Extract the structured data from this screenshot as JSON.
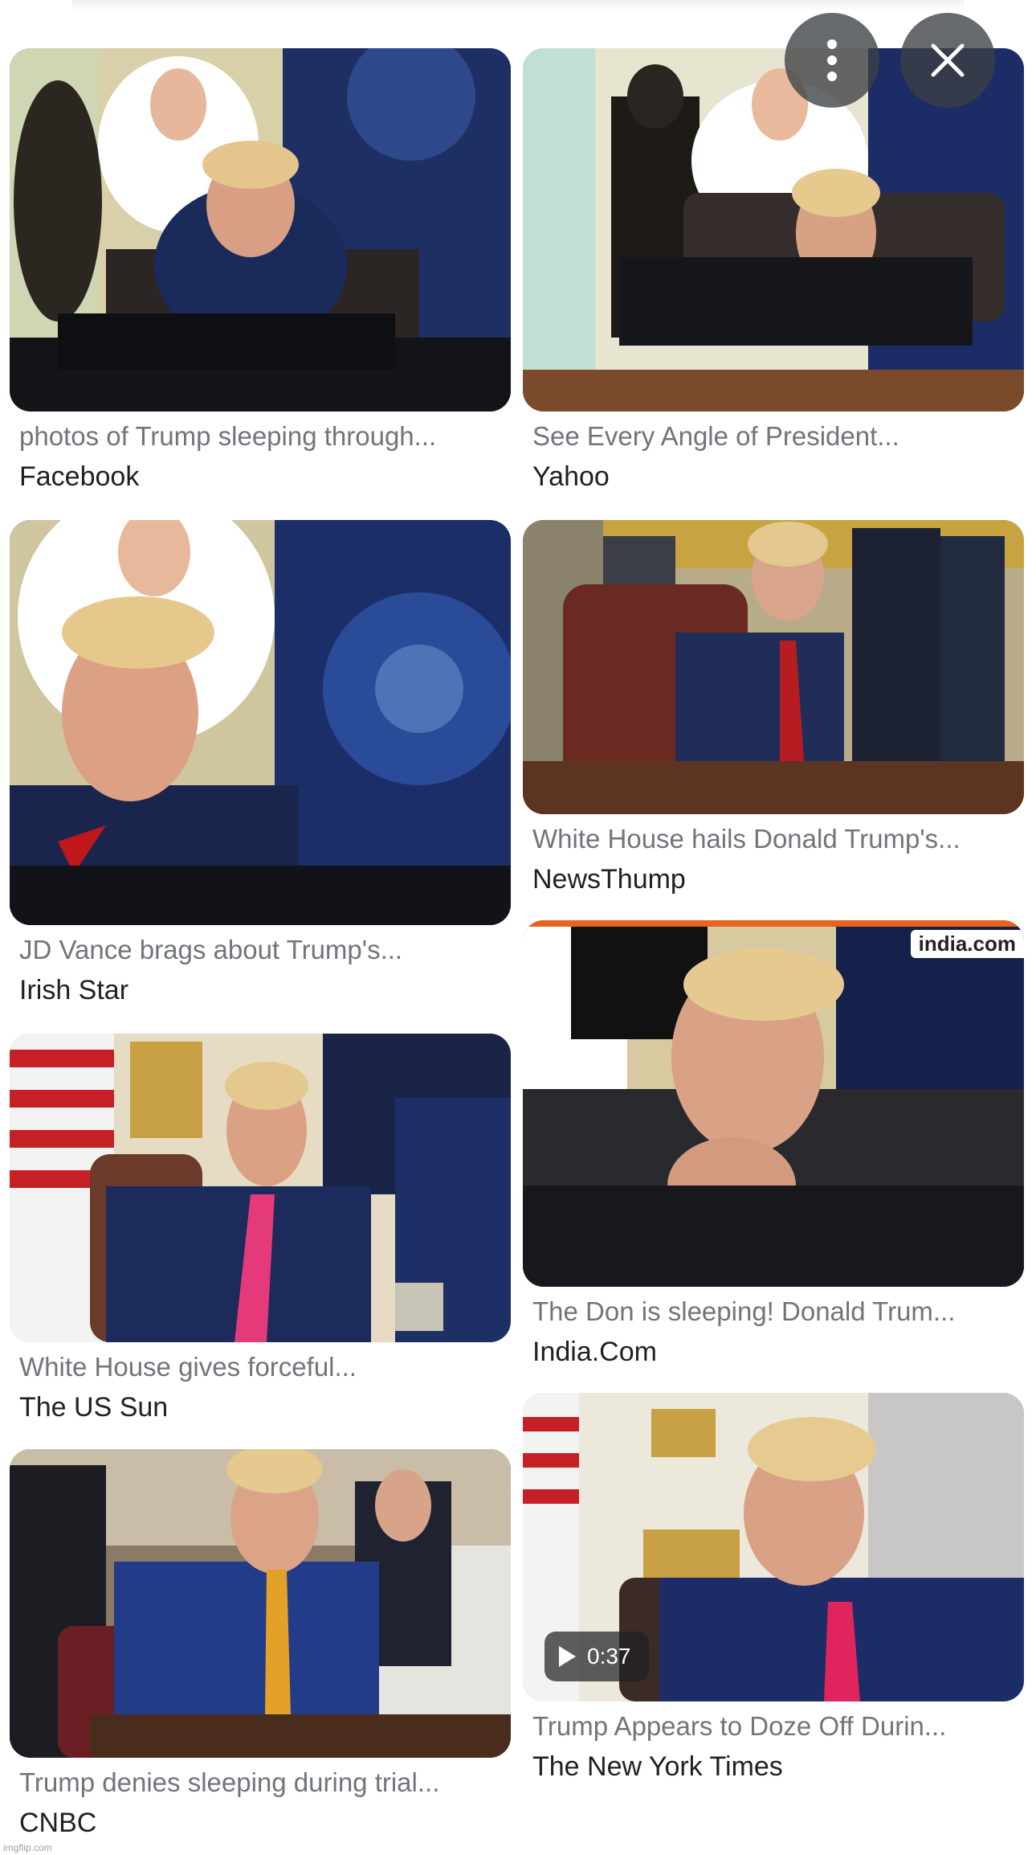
{
  "top_buttons": {
    "more_icon": "more-vert-icon",
    "close_icon": "close-icon"
  },
  "results": [
    {
      "caption": "photos of Trump sleeping through...",
      "source": "Facebook"
    },
    {
      "caption": "See Every Angle of President...",
      "source": "Yahoo"
    },
    {
      "caption": "JD Vance brags about Trump's...",
      "source": "Irish Star"
    },
    {
      "caption": "White House hails Donald Trump's...",
      "source": "NewsThump"
    },
    {
      "caption": "White House gives forceful...",
      "source": "The US Sun"
    },
    {
      "caption": "The Don is sleeping! Donald Trum...",
      "source": "India.Com",
      "logo_text": "india.com"
    },
    {
      "caption": "Trump denies sleeping during trial...",
      "source": "CNBC"
    },
    {
      "caption": "Trump Appears to Doze Off Durin...",
      "source": "The New York Times",
      "video_duration": "0:37"
    }
  ],
  "watermark": "imgflip.com"
}
